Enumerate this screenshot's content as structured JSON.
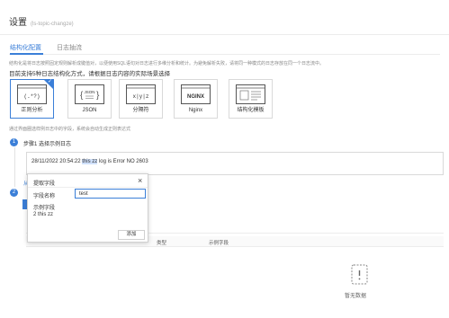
{
  "header": {
    "title": "设置",
    "subtitle": "(ls-topic-changze)"
  },
  "tabs": [
    {
      "label": "结构化配置",
      "active": true
    },
    {
      "label": "日志抽流",
      "active": false
    }
  ],
  "description": "结构化是将日志按照固定规则解析成键值对，以便使用SQL语句对日志进行多维分析和统计。为避免解析失败，请将同一种模式的日志存放在同一个日志流中。",
  "prompt": "目前支持5种日志结构化方式，请根据日志内容的实际场景选择",
  "parse_methods": [
    {
      "label": "正则分析",
      "icon": "regex-icon",
      "glyph": "(.*?)",
      "selected": true
    },
    {
      "label": "JSON",
      "icon": "json-icon",
      "glyph": "JSON",
      "selected": false
    },
    {
      "label": "分隔符",
      "icon": "delimiter-icon",
      "glyph": "x|y|z",
      "selected": false
    },
    {
      "label": "Nginx",
      "icon": "nginx-icon",
      "glyph": "NGINX",
      "selected": false
    },
    {
      "label": "结构化模板",
      "icon": "template-icon",
      "glyph": "",
      "selected": false
    }
  ],
  "note": "通过界面圈选样例日志中的字段，系统会自动生成正则表达式",
  "step1": {
    "number": "1",
    "label": "步骤1 选择示例日志",
    "sample_log_prefix": "28/11/2022 20:54:22 ",
    "sample_log_highlight": "this zz",
    "sample_log_suffix": " log is Error NO 2603"
  },
  "step2": {
    "number": "2",
    "link_char": "从"
  },
  "table": {
    "col_type": "类型",
    "col_example": "示例字段"
  },
  "popup": {
    "title": "提取字段",
    "close_glyph": "×",
    "field_name_label": "字段名称",
    "field_name_value": "test",
    "example_label": "示例字段",
    "example_value": "2 this zz",
    "add_button": "添加"
  },
  "empty_state": {
    "text": "暂无数据"
  },
  "colors": {
    "accent": "#3b7fd8",
    "border": "#d9d9d9"
  }
}
